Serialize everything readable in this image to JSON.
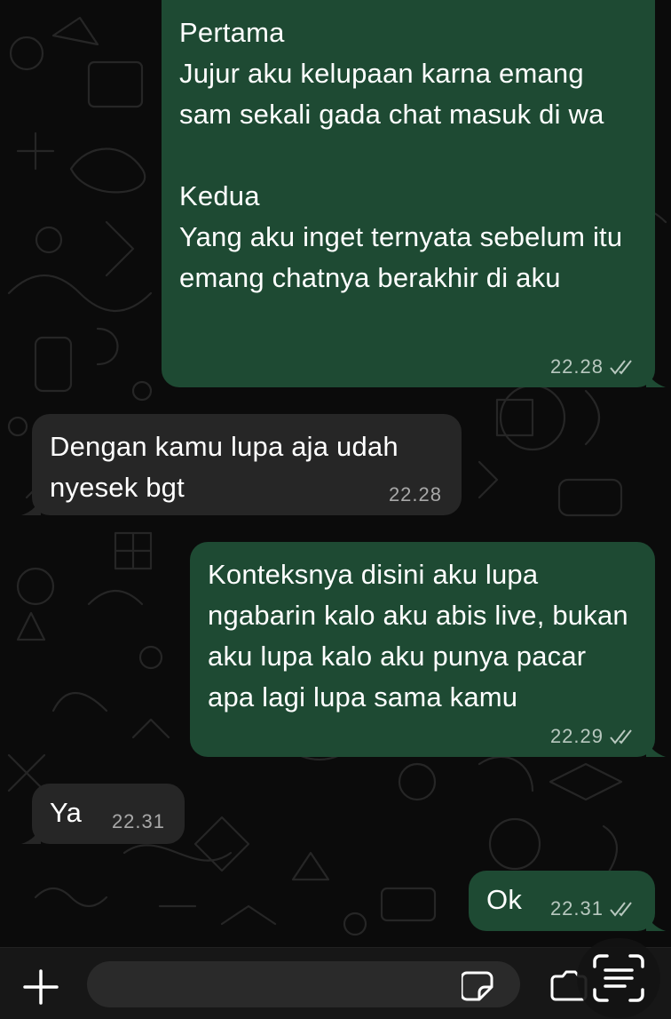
{
  "chat": {
    "messages": [
      {
        "direction": "outgoing",
        "text": "Pertama\nJujur aku kelupaan karna emang sam sekali gada chat masuk di wa\n\nKedua\nYang aku inget ternyata sebelum itu emang chatnya berakhir di aku",
        "time": "22.28",
        "status": "read"
      },
      {
        "direction": "incoming",
        "text": "Dengan kamu lupa aja udah nyesek bgt",
        "time": "22.28"
      },
      {
        "direction": "outgoing",
        "text": "Konteksnya disini aku lupa ngabarin kalo aku abis live, bukan aku lupa kalo aku punya pacar apa lagi lupa sama kamu",
        "time": "22.29",
        "status": "read"
      },
      {
        "direction": "incoming",
        "text": "Ya",
        "time": "22.31"
      },
      {
        "direction": "outgoing",
        "text": "Ok",
        "time": "22.31",
        "status": "read"
      }
    ]
  },
  "composer": {
    "placeholder": "",
    "icons": {
      "attach": "plus-icon",
      "sticker": "sticker-icon",
      "camera": "camera-icon",
      "scan": "text-scan-icon"
    }
  },
  "colors": {
    "outgoing_bubble": "#1e4a33",
    "incoming_bubble": "#262626",
    "background": "#0b0b0b",
    "timestamp_out": "#b8c8bf",
    "timestamp_in": "#a8a8a8"
  }
}
